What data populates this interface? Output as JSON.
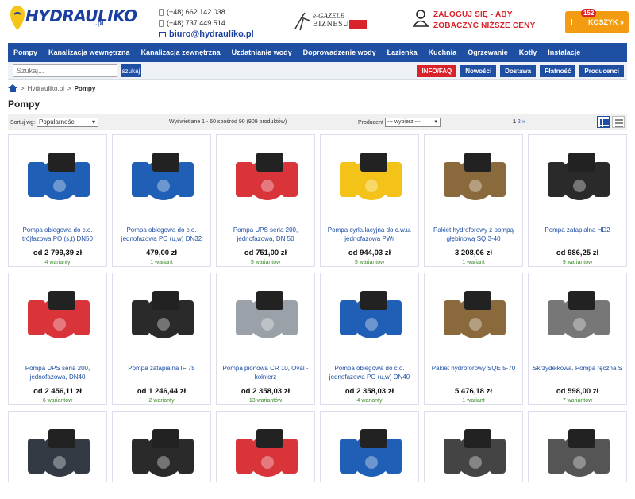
{
  "header": {
    "logo": "HYDRAULIKO",
    "logo_sub": ".pl",
    "phone1": "(+48) 662 142 038",
    "phone2": "(+48) 737 449 514",
    "email": "biuro@hydrauliko.pl",
    "gazele_line1": "e-GAZELE",
    "gazele_line2": "BIZNESU",
    "login_line1": "ZALOGUJ SIĘ - ABY",
    "login_line2": "ZOBACZYĆ NIŻSZE CENY",
    "cart_label": "KOSZYK »",
    "cart_count": "152"
  },
  "nav": [
    "Pompy",
    "Kanalizacja wewnętrzna",
    "Kanalizacja zewnętrzna",
    "Uzdatnianie wody",
    "Doprowadzenie wody",
    "Łazienka",
    "Kuchnia",
    "Ogrzewanie",
    "Kotły",
    "Instalacje"
  ],
  "search": {
    "placeholder": "Szukaj...",
    "button": "szukaj"
  },
  "buttons": {
    "info": "INFO/FAQ",
    "news": "Nowości",
    "delivery": "Dostawa",
    "payment": "Płatność",
    "producers": "Producenci"
  },
  "breadcrumb": {
    "home": "Hydrauliko.pl",
    "sep": ">",
    "current": "Pompy"
  },
  "page_title": "Pompy",
  "toolbar": {
    "sort_label": "Sortuj wg:",
    "sort_value": "Popularności",
    "count_text": "Wyświetlane 1 - 60 spośród 90 (909 produktów)",
    "producer_label": "Producent",
    "producer_value": "--- wybierz ---",
    "page_current": "1",
    "page_next": "2",
    "page_arrow": "»"
  },
  "products": [
    {
      "name": "Pompa obiegowa do c.o. trójfazowa PO (s,t) DN50",
      "price": "od 2 799,39 zł",
      "variants": "4 warianty",
      "color": "#1f5fb5"
    },
    {
      "name": "Pompa obiegowa do c.o. jednofazowa PO (u,w) DN32",
      "price": "479,00 zł",
      "variants": "1 wariant",
      "color": "#1f5fb5"
    },
    {
      "name": "Pompa UPS seria 200, jednofazowa, DN 50",
      "price": "od 751,00 zł",
      "variants": "5 wariantów",
      "color": "#d8343a"
    },
    {
      "name": "Pompa cyrkulacyjna do c.w.u. jednofazowa PWr",
      "price": "od 944,03 zł",
      "variants": "5 wariantów",
      "color": "#f3c31a"
    },
    {
      "name": "Pakiet hydroforowy z pompą głębinową SQ 3-40",
      "price": "3 208,06 zł",
      "variants": "1 wariant",
      "color": "#8a6a3c"
    },
    {
      "name": "Pompa zatapialna HD2",
      "price": "od 986,25 zł",
      "variants": "9 wariantów",
      "color": "#2a2a2a"
    },
    {
      "name": "Pompa UPS seria 200, jednofazowa, DN40",
      "price": "od 2 456,11 zł",
      "variants": "6 wariantów",
      "color": "#d8343a"
    },
    {
      "name": "Pompa zatapialna IF 75",
      "price": "od 1 246,44 zł",
      "variants": "2 warianty",
      "color": "#2a2a2a"
    },
    {
      "name": "Pompa pionowa CR 10, Oval - kołnierz",
      "price": "od 2 358,03 zł",
      "variants": "13 wariantów",
      "color": "#9aa1a8"
    },
    {
      "name": "Pompa obiegowa do c.o. jednofazowa PO (u,w) DN40",
      "price": "od 2 358,03 zł",
      "variants": "4 warianty",
      "color": "#1f5fb5"
    },
    {
      "name": "Pakiet hydroforowy SQE 5-70",
      "price": "5 476,18 zł",
      "variants": "1 wariant",
      "color": "#8a6a3c"
    },
    {
      "name": "Skrzydełkowa. Pompa ręczna S",
      "price": "od 598,00 zł",
      "variants": "7 wariantów",
      "color": "#777"
    },
    {
      "name": "",
      "price": "",
      "variants": "",
      "color": "#333a44"
    },
    {
      "name": "",
      "price": "",
      "variants": "",
      "color": "#2a2a2a"
    },
    {
      "name": "",
      "price": "",
      "variants": "",
      "color": "#d8343a"
    },
    {
      "name": "",
      "price": "",
      "variants": "",
      "color": "#1f5fb5"
    },
    {
      "name": "",
      "price": "",
      "variants": "",
      "color": "#444"
    },
    {
      "name": "",
      "price": "",
      "variants": "",
      "color": "#555"
    }
  ]
}
